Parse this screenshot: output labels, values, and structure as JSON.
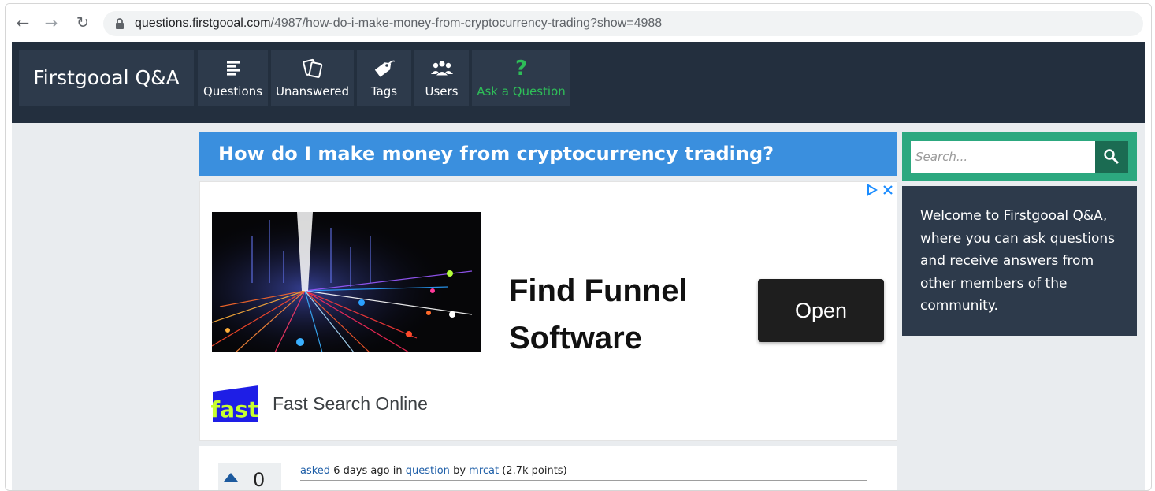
{
  "browser": {
    "url_host": "questions.firstgooal.com",
    "url_path": "/4987/how-do-i-make-money-from-cryptocurrency-trading?show=4988"
  },
  "site": {
    "brand": "Firstgooal Q&A",
    "nav": [
      {
        "label": "Questions",
        "icon": "list-icon"
      },
      {
        "label": "Unanswered",
        "icon": "cards-icon"
      },
      {
        "label": "Tags",
        "icon": "tag-icon"
      },
      {
        "label": "Users",
        "icon": "users-icon"
      },
      {
        "label": "Ask a Question",
        "icon": "question-mark-icon",
        "glyph": "?"
      }
    ],
    "colors": {
      "header_bg": "#232f3e",
      "nav_tile_bg": "#2d3a4b",
      "ask_accent": "#2ebd58",
      "title_bar": "#3a8fde",
      "search_frame": "#2ca87f",
      "search_button": "#1b6b52"
    }
  },
  "question": {
    "title": "How do I make money from cryptocurrency trading?",
    "votes": "0",
    "meta": {
      "asked_label": "asked",
      "time": "6 days ago",
      "in_label": "in",
      "category": "question",
      "by_label": "by",
      "author": "mrcat",
      "points": "(2.7k points)"
    }
  },
  "ad": {
    "headline_line1": "Find Funnel",
    "headline_line2": "Software",
    "cta": "Open",
    "advertiser": "Fast Search Online",
    "logo_text": "fast"
  },
  "sidebar": {
    "search_placeholder": "Search...",
    "welcome": "Welcome to Firstgooal Q&A, where you can ask questions and receive answers from other members of the community."
  }
}
